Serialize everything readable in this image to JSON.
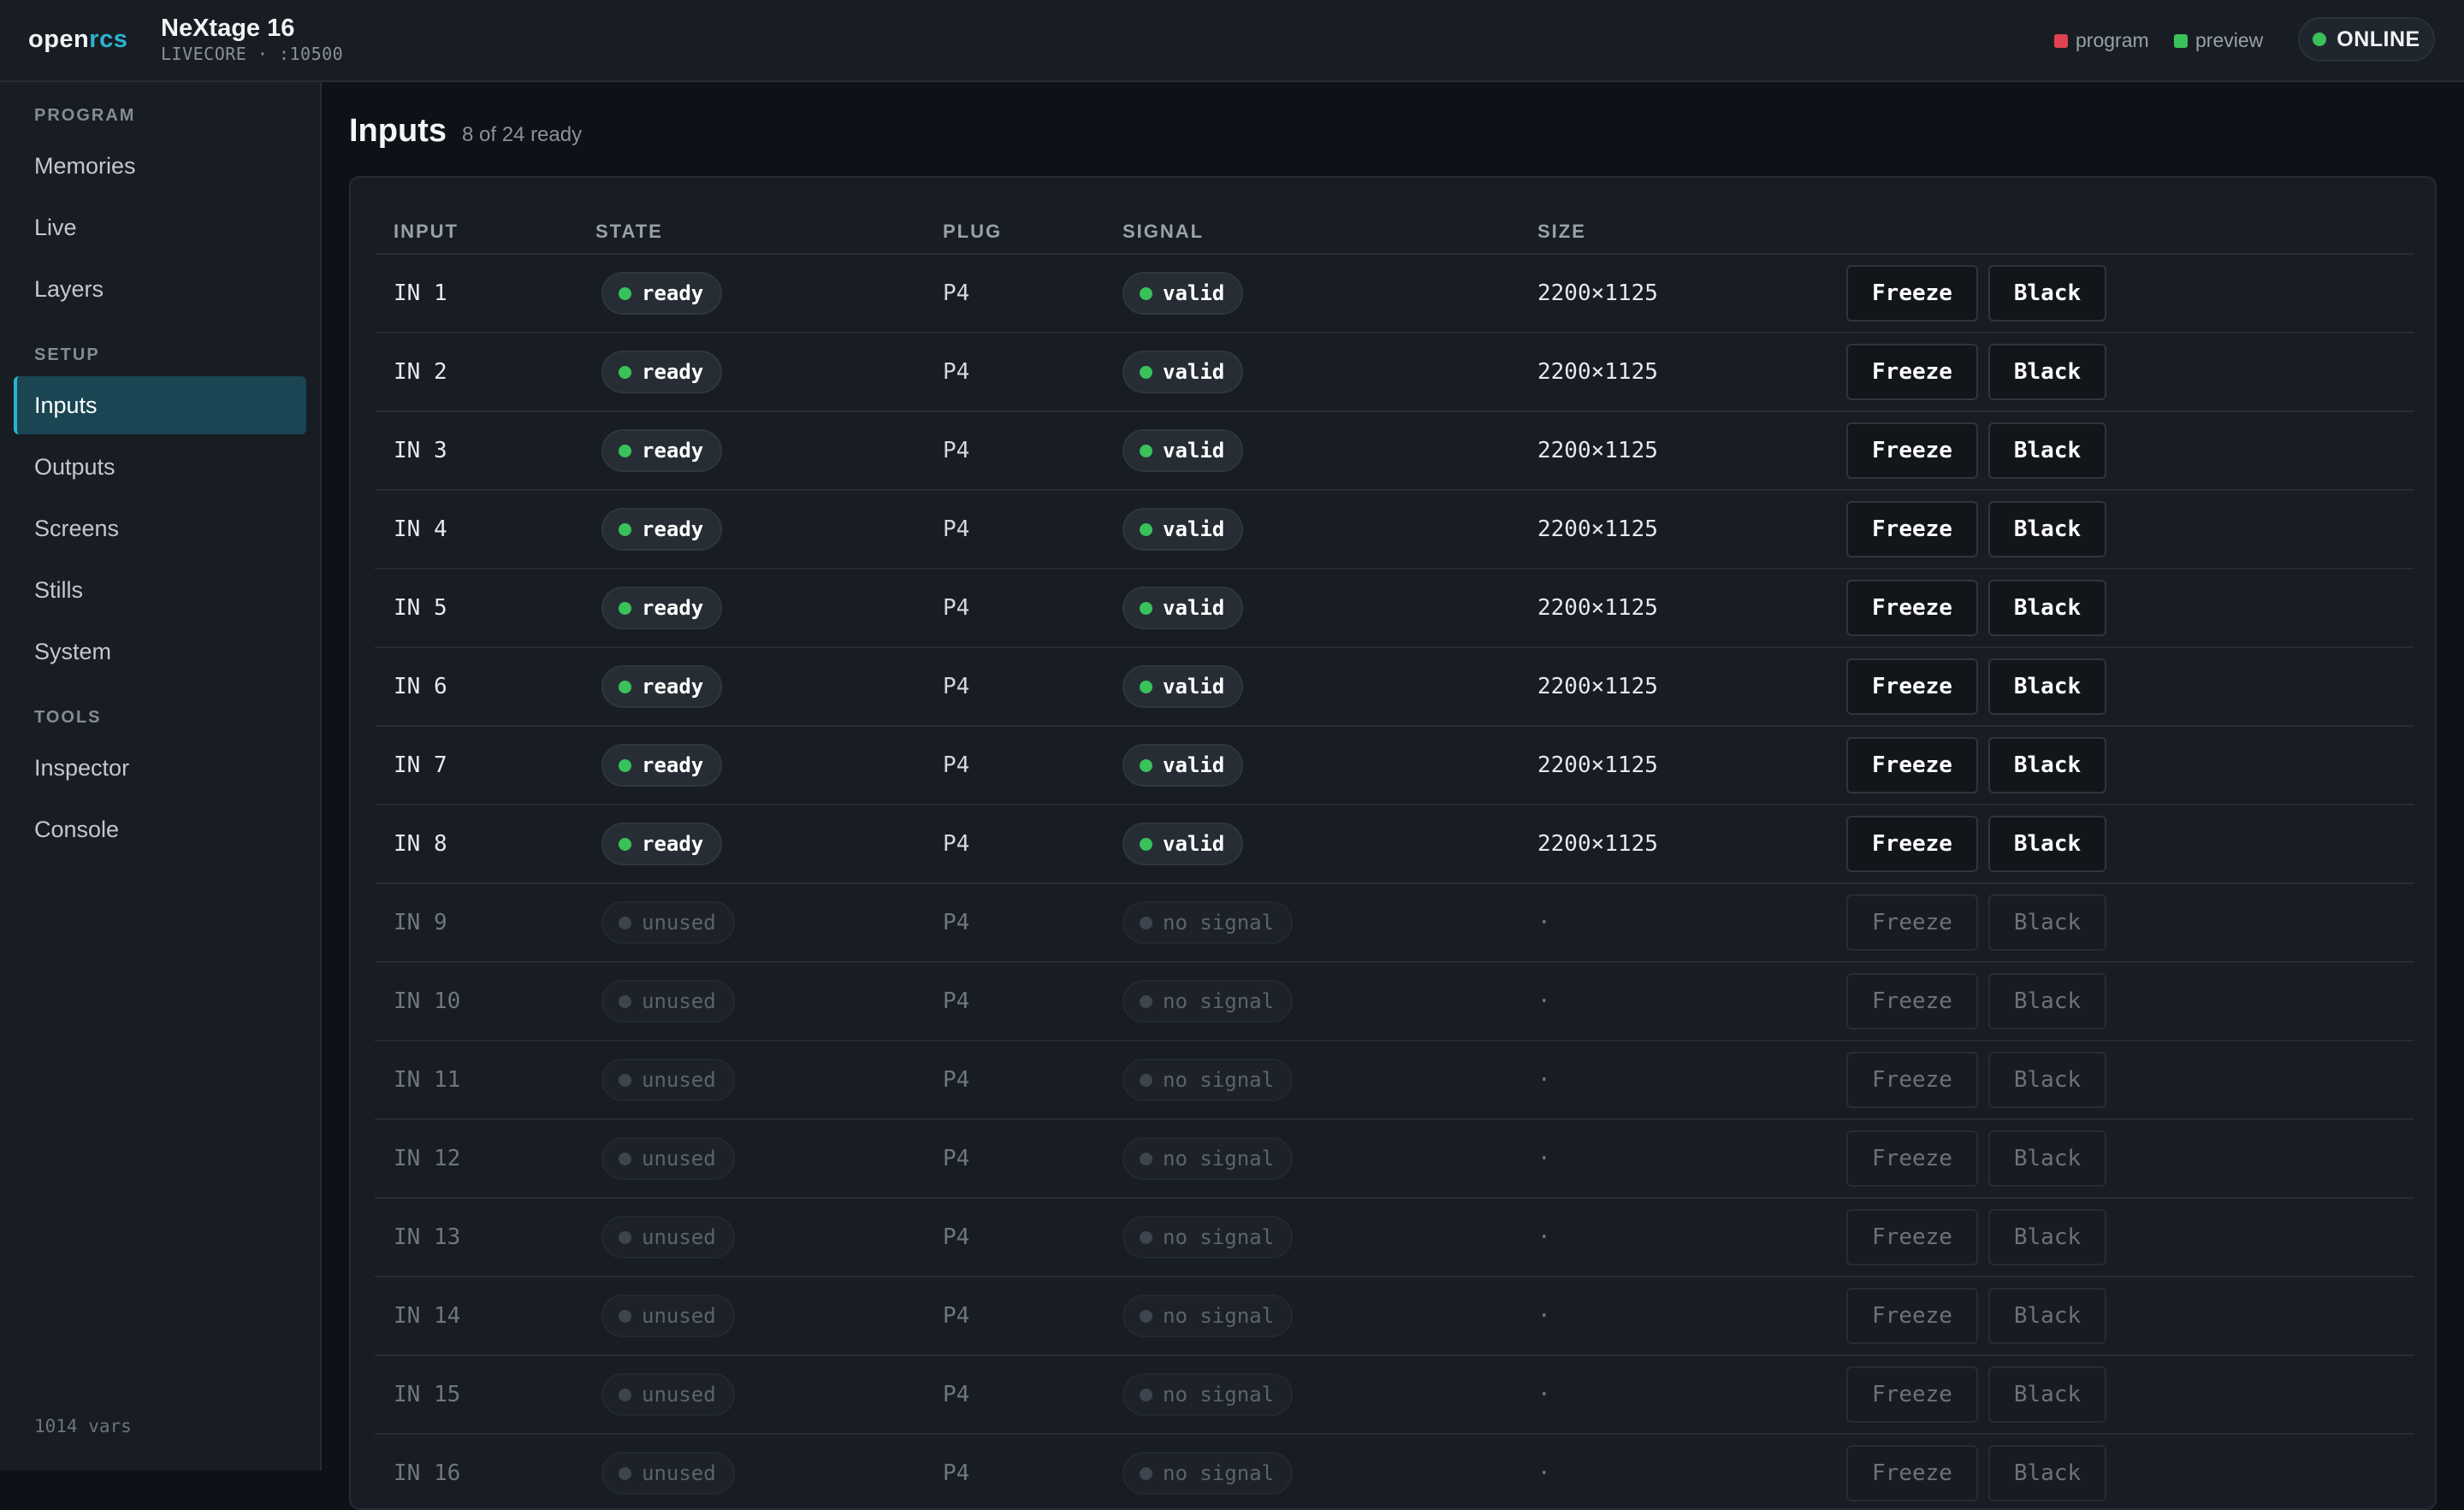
{
  "header": {
    "brand_open": "open",
    "brand_rcs": "rcs",
    "device_title": "NeXtage 16",
    "device_subtitle": "LIVECORE · :10500",
    "legend_program": "program",
    "legend_preview": "preview",
    "status": "ONLINE",
    "colors": {
      "program": "#e0424f",
      "preview": "#39c25a",
      "online": "#39c25a",
      "accent": "#2bb3cf"
    }
  },
  "sidebar": {
    "sections": [
      {
        "label": "PROGRAM",
        "items": [
          "Memories",
          "Live",
          "Layers"
        ]
      },
      {
        "label": "SETUP",
        "items": [
          "Inputs",
          "Outputs",
          "Screens",
          "Stills",
          "System"
        ]
      },
      {
        "label": "TOOLS",
        "items": [
          "Inspector",
          "Console"
        ]
      }
    ],
    "active_item": "Inputs",
    "footer": "1014 vars"
  },
  "main": {
    "title": "Inputs",
    "subtitle": "8 of 24 ready",
    "columns": [
      "INPUT",
      "STATE",
      "PLUG",
      "SIGNAL",
      "SIZE"
    ],
    "actions": {
      "freeze": "Freeze",
      "black": "Black"
    },
    "rows": [
      {
        "input": "IN 1",
        "state": "ready",
        "plug": "P4",
        "signal": "valid",
        "size": "2200×1125",
        "active": true
      },
      {
        "input": "IN 2",
        "state": "ready",
        "plug": "P4",
        "signal": "valid",
        "size": "2200×1125",
        "active": true
      },
      {
        "input": "IN 3",
        "state": "ready",
        "plug": "P4",
        "signal": "valid",
        "size": "2200×1125",
        "active": true
      },
      {
        "input": "IN 4",
        "state": "ready",
        "plug": "P4",
        "signal": "valid",
        "size": "2200×1125",
        "active": true
      },
      {
        "input": "IN 5",
        "state": "ready",
        "plug": "P4",
        "signal": "valid",
        "size": "2200×1125",
        "active": true
      },
      {
        "input": "IN 6",
        "state": "ready",
        "plug": "P4",
        "signal": "valid",
        "size": "2200×1125",
        "active": true
      },
      {
        "input": "IN 7",
        "state": "ready",
        "plug": "P4",
        "signal": "valid",
        "size": "2200×1125",
        "active": true
      },
      {
        "input": "IN 8",
        "state": "ready",
        "plug": "P4",
        "signal": "valid",
        "size": "2200×1125",
        "active": true
      },
      {
        "input": "IN 9",
        "state": "unused",
        "plug": "P4",
        "signal": "no signal",
        "size": "·",
        "active": false
      },
      {
        "input": "IN 10",
        "state": "unused",
        "plug": "P4",
        "signal": "no signal",
        "size": "·",
        "active": false
      },
      {
        "input": "IN 11",
        "state": "unused",
        "plug": "P4",
        "signal": "no signal",
        "size": "·",
        "active": false
      },
      {
        "input": "IN 12",
        "state": "unused",
        "plug": "P4",
        "signal": "no signal",
        "size": "·",
        "active": false
      },
      {
        "input": "IN 13",
        "state": "unused",
        "plug": "P4",
        "signal": "no signal",
        "size": "·",
        "active": false
      },
      {
        "input": "IN 14",
        "state": "unused",
        "plug": "P4",
        "signal": "no signal",
        "size": "·",
        "active": false
      },
      {
        "input": "IN 15",
        "state": "unused",
        "plug": "P4",
        "signal": "no signal",
        "size": "·",
        "active": false
      },
      {
        "input": "IN 16",
        "state": "unused",
        "plug": "P4",
        "signal": "no signal",
        "size": "·",
        "active": false
      }
    ]
  }
}
